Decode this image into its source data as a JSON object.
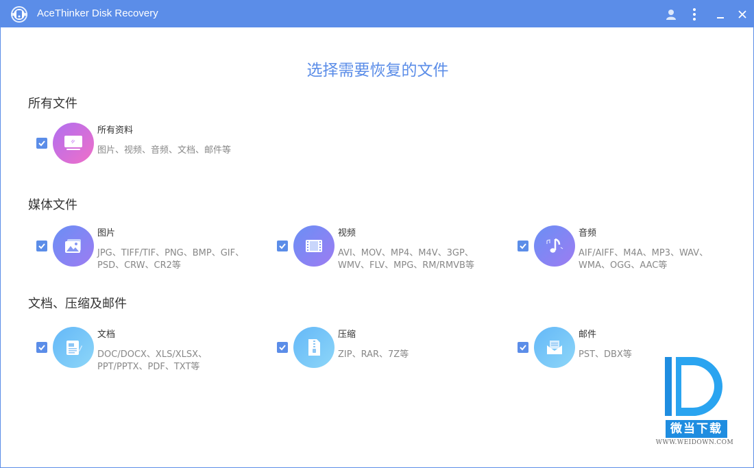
{
  "window": {
    "title": "AceThinker Disk Recovery"
  },
  "titlebar_icons": [
    "user-icon",
    "more-icon",
    "minimize-icon",
    "close-icon"
  ],
  "colors": {
    "accent": "#5b8de8",
    "check": "#5b8de8",
    "all_gradient": [
      "#b06ff0",
      "#f06fc8"
    ],
    "media_gradient": [
      "#6a8ff5",
      "#9d7cf2"
    ],
    "doc_gradient": [
      "#64b8f8",
      "#8dd6f8"
    ]
  },
  "main": {
    "heading": "选择需要恢复的文件",
    "sections": [
      {
        "title": "所有文件",
        "items": [
          {
            "label": "所有资料",
            "desc": "图片、视频、音频、文档、邮件等",
            "icon": "monitor-icon",
            "checked": true
          }
        ]
      },
      {
        "title": "媒体文件",
        "items": [
          {
            "label": "图片",
            "desc": "JPG、TIFF/TIF、PNG、BMP、GIF、PSD、CRW、CR2等",
            "icon": "picture-icon",
            "checked": true
          },
          {
            "label": "视频",
            "desc": "AVI、MOV、MP4、M4V、3GP、WMV、FLV、MPG、RM/RMVB等",
            "icon": "video-icon",
            "checked": true
          },
          {
            "label": "音频",
            "desc": "AIF/AIFF、M4A、MP3、WAV、WMA、OGG、AAC等",
            "icon": "music-icon",
            "checked": true
          }
        ]
      },
      {
        "title": "文档、压缩及邮件",
        "items": [
          {
            "label": "文档",
            "desc": "DOC/DOCX、XLS/XLSX、PPT/PPTX、PDF、TXT等",
            "icon": "document-icon",
            "checked": true
          },
          {
            "label": "压缩",
            "desc": "ZIP、RAR、7Z等",
            "icon": "zip-icon",
            "checked": true
          },
          {
            "label": "邮件",
            "desc": "PST、DBX等",
            "icon": "mail-icon",
            "checked": true
          }
        ]
      }
    ]
  },
  "watermark": {
    "text": "微当下载",
    "sub": "WWW.WEIDOWN.COM"
  }
}
